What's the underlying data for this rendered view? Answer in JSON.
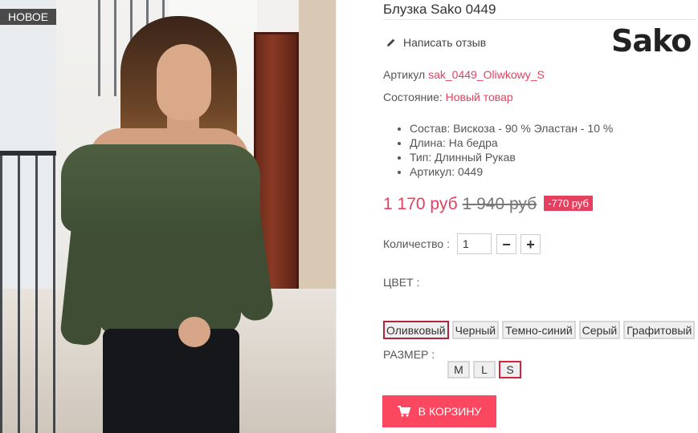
{
  "badge": {
    "label": "НОВОЕ"
  },
  "product": {
    "title": "Блузка Sako 0449",
    "brand_logo": "Sako",
    "review_link": "Написать отзыв",
    "sku_label": "Артикул",
    "sku_value": "sak_0449_Oliwkowy_S",
    "condition_label": "Состояние:",
    "condition_value": "Новый товар",
    "features": [
      "Состав: Вискоза - 90 % Эластан - 10 %",
      "Длина: На бедра",
      "Тип: Длинный Рукав",
      "Артикул: 0449"
    ]
  },
  "price": {
    "current": "1 170 руб",
    "old": "1 940 руб",
    "discount": "-770 руб"
  },
  "quantity": {
    "label": "Количество :",
    "value": "1",
    "minus": "−",
    "plus": "+"
  },
  "color": {
    "label": "ЦВЕТ :",
    "options": [
      "Оливковый",
      "Черный",
      "Темно-синий",
      "Серый",
      "Графитовый"
    ],
    "selected": "Оливковый"
  },
  "size": {
    "label": "РАЗМЕР :",
    "options": [
      "M",
      "L",
      "S"
    ],
    "selected": "S"
  },
  "cart": {
    "label": "В КОРЗИНУ"
  },
  "colors": {
    "accent": "#e4405f",
    "button": "#fb4860",
    "badge_bg": "#4a4a4a"
  },
  "icons": {
    "review": "pencil-icon",
    "cart": "shopping-cart-icon"
  }
}
